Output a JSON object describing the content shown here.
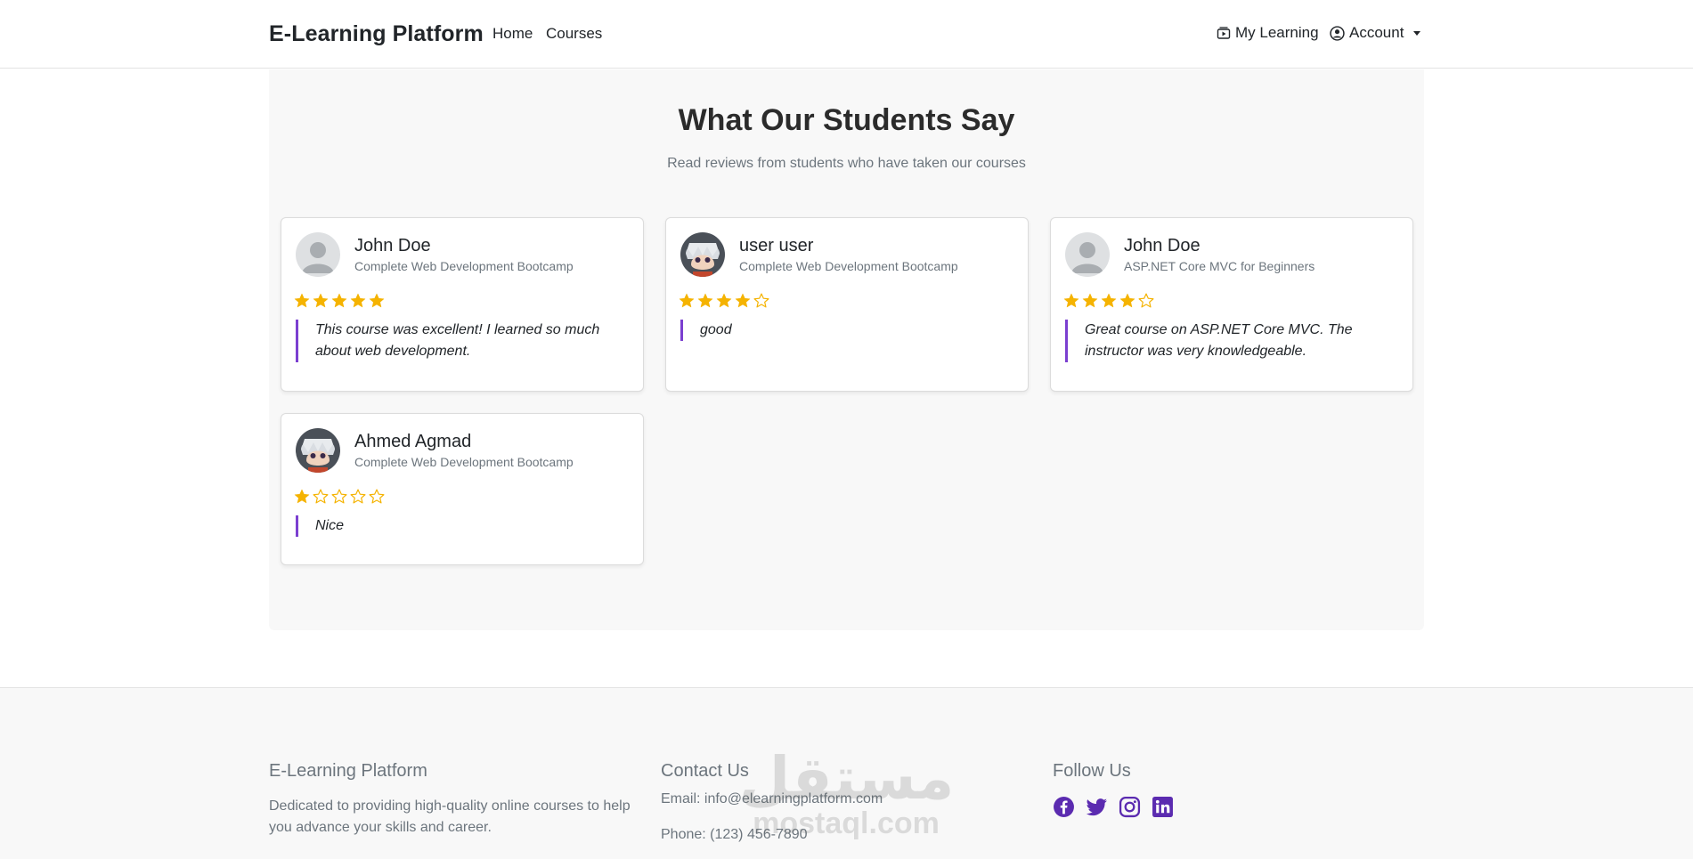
{
  "navbar": {
    "brand": "E-Learning Platform",
    "links": [
      "Home",
      "Courses"
    ],
    "my_learning": "My Learning",
    "account": "Account"
  },
  "reviews_section": {
    "title": "What Our Students Say",
    "subtitle": "Read reviews from students who have taken our courses",
    "star_color": "#f5b301",
    "accent_color": "#7b3fd0",
    "reviews": [
      {
        "name": "John Doe",
        "course": "Complete Web Development Bootcamp",
        "rating": 5,
        "comment": "This course was excellent! I learned so much about web development.",
        "avatar": "default-avatar-icon"
      },
      {
        "name": "user user",
        "course": "Complete Web Development Bootcamp",
        "rating": 4,
        "comment": "good",
        "avatar": "anime-avatar"
      },
      {
        "name": "John Doe",
        "course": "ASP.NET Core MVC for Beginners",
        "rating": 4,
        "comment": "Great course on ASP.NET Core MVC. The instructor was very knowledgeable.",
        "avatar": "default-avatar-icon"
      },
      {
        "name": "Ahmed Agmad",
        "course": "Complete Web Development Bootcamp",
        "rating": 1,
        "comment": "Nice",
        "avatar": "anime-avatar"
      }
    ]
  },
  "footer": {
    "about": {
      "heading": "E-Learning Platform",
      "text": "Dedicated to providing high-quality online courses to help you advance your skills and career."
    },
    "contact": {
      "heading": "Contact Us",
      "email": "Email: info@elearningplatform.com",
      "phone": "Phone: (123) 456-7890"
    },
    "follow": {
      "heading": "Follow Us",
      "icons": [
        "facebook-icon",
        "twitter-icon",
        "instagram-icon",
        "linkedin-icon"
      ],
      "icon_color": "#5b2bb0"
    }
  },
  "watermark": {
    "arabic": "مستقل",
    "latin": "mostaql.com"
  }
}
